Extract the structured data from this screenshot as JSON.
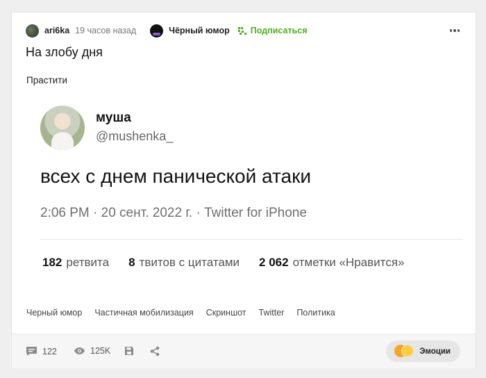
{
  "header": {
    "author": "ari6ka",
    "time": "19 часов назад",
    "community": "Чёрный юмор",
    "subscribe_label": "Подписаться",
    "more_icon": "more-dots-icon"
  },
  "post": {
    "title": "На злобу дня",
    "caption": "Прастити"
  },
  "tweet": {
    "name": "муша",
    "handle": "@mushenka_",
    "text": "всех с днем панической атаки",
    "meta": "2:06 PM · 20 сент. 2022 г. · Twitter for iPhone",
    "stats": [
      {
        "value": "182",
        "label": "ретвита"
      },
      {
        "value": "8",
        "label": "твитов с цитатами"
      },
      {
        "value": "2 062",
        "label": "отметки «Нравится»"
      }
    ]
  },
  "tags": [
    "Черный юмор",
    "Частичная мобилизация",
    "Скриншот",
    "Twitter",
    "Политика"
  ],
  "footer": {
    "comments": "122",
    "views": "125K",
    "emotions_label": "Эмоции"
  },
  "colors": {
    "accent_green": "#4caf1c",
    "background": "#efefef"
  }
}
